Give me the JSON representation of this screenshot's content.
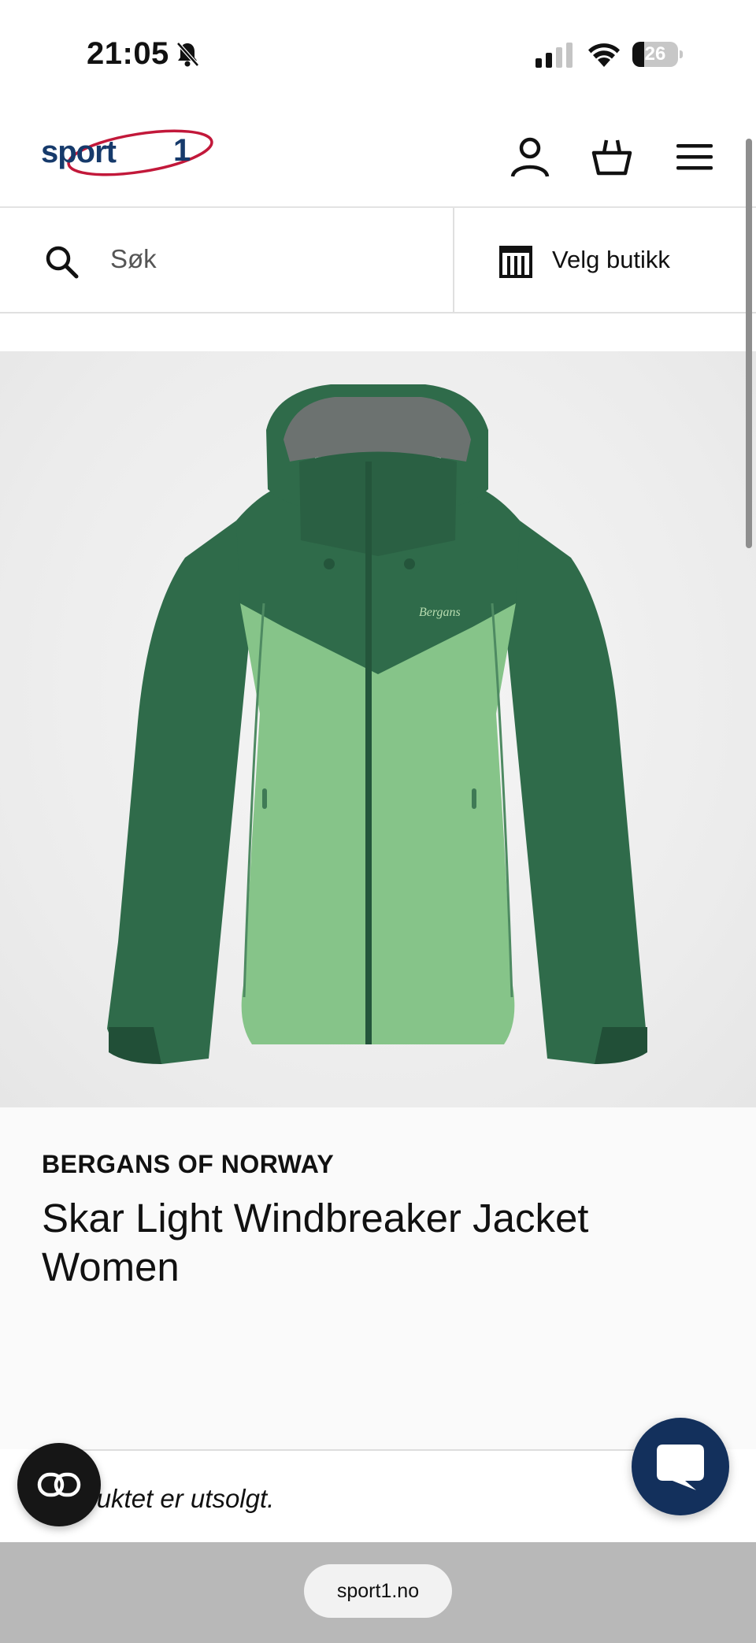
{
  "status_bar": {
    "time": "21:05",
    "battery": "26",
    "battery_level": 0.26
  },
  "header": {
    "logo_text": "sport 1",
    "icons": [
      "user-icon",
      "basket-icon",
      "menu-icon"
    ]
  },
  "search": {
    "placeholder": "Søk",
    "store_label": "Velg butikk"
  },
  "product": {
    "brand": "BERGANS OF NORWAY",
    "title": "Skar Light Windbreaker Jacket Women",
    "image_logo_text": "Bergans",
    "stock_message": "Produktet er utsolgt.",
    "colors": {
      "dark_green": "#2f6b4a",
      "light_green": "#86c489"
    }
  },
  "browser": {
    "url": "sport1.no"
  },
  "colors": {
    "brand_blue": "#163a6b",
    "brand_red": "#c2183a",
    "chat_button": "#13305c"
  }
}
